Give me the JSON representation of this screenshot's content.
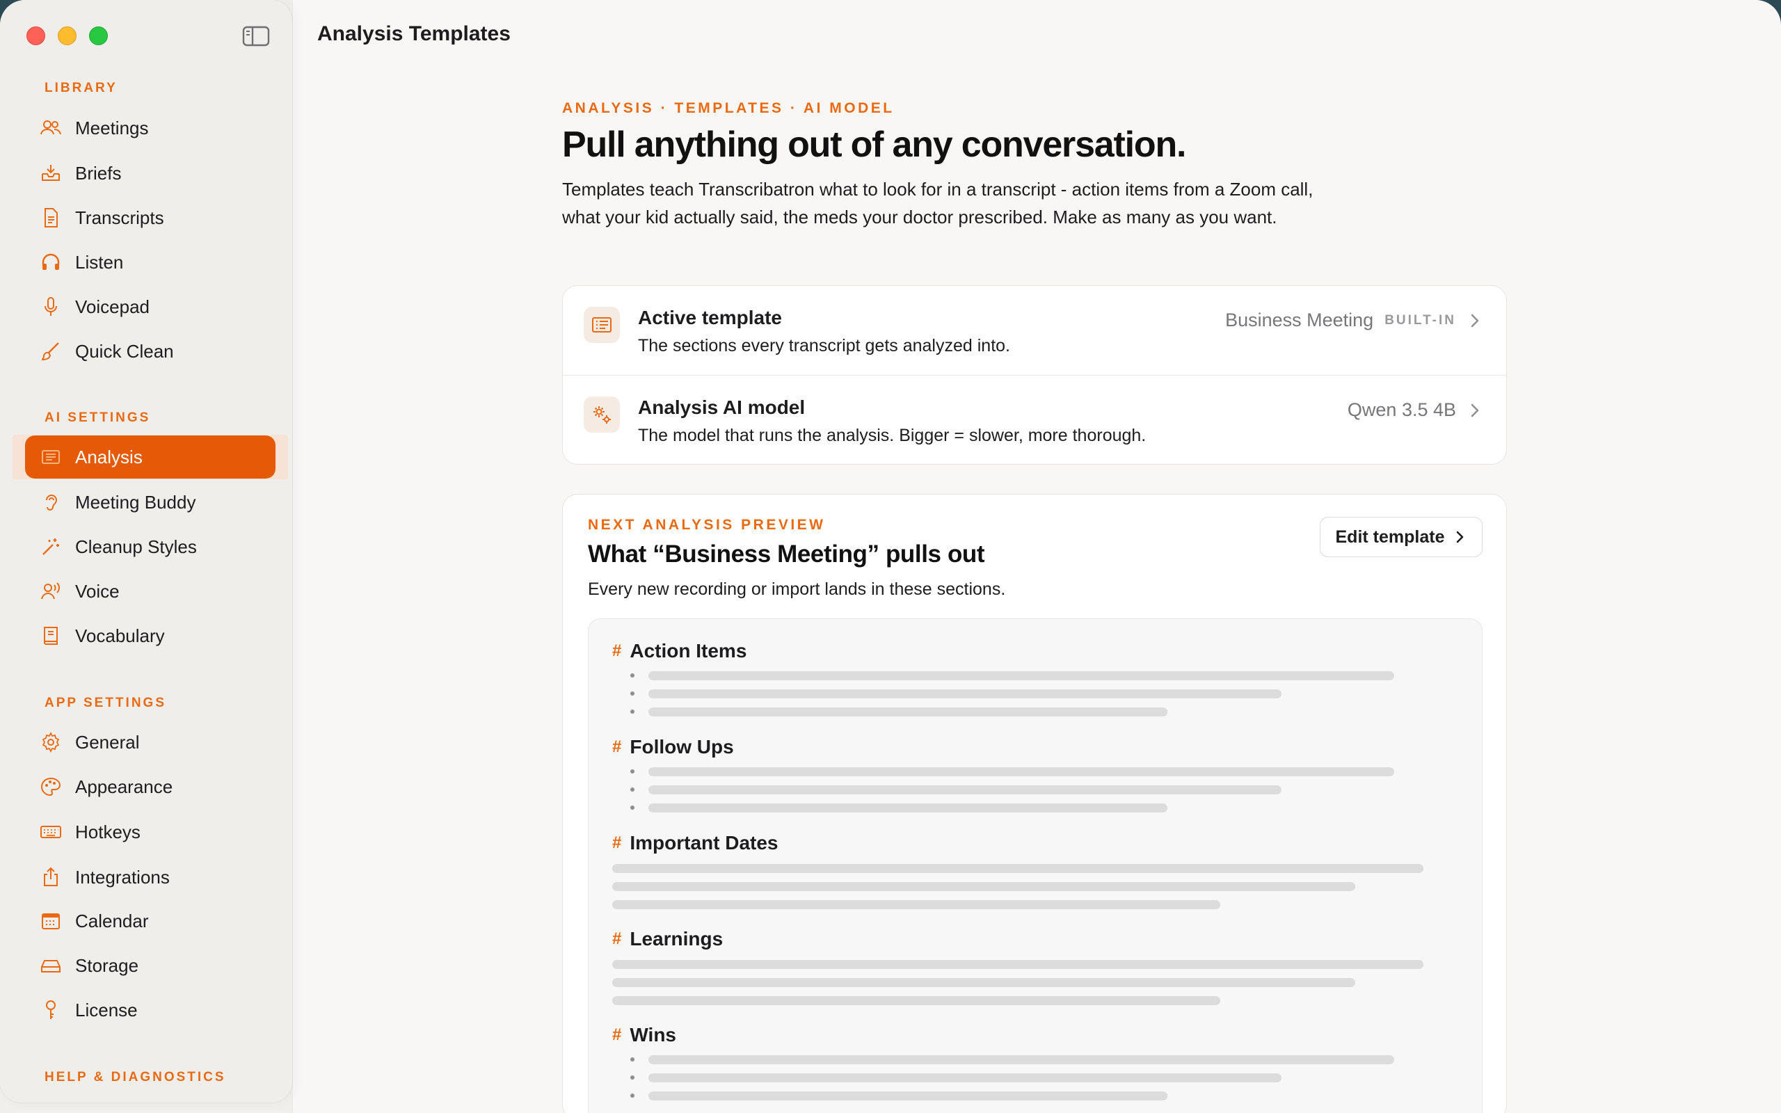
{
  "window": {
    "title": "Analysis Templates"
  },
  "sidebar": {
    "sections": [
      {
        "label": "LIBRARY"
      },
      {
        "label": "AI SETTINGS"
      },
      {
        "label": "APP SETTINGS"
      },
      {
        "label": "HELP & DIAGNOSTICS"
      }
    ],
    "items": [
      {
        "label": "Meetings",
        "icon": "people-icon"
      },
      {
        "label": "Briefs",
        "icon": "tray-download-icon"
      },
      {
        "label": "Transcripts",
        "icon": "document-icon"
      },
      {
        "label": "Listen",
        "icon": "headphones-icon"
      },
      {
        "label": "Voicepad",
        "icon": "microphone-icon"
      },
      {
        "label": "Quick Clean",
        "icon": "brush-icon"
      },
      {
        "label": "Analysis",
        "icon": "list-card-icon",
        "active": true
      },
      {
        "label": "Meeting Buddy",
        "icon": "ear-icon"
      },
      {
        "label": "Cleanup Styles",
        "icon": "magic-wand-icon"
      },
      {
        "label": "Voice",
        "icon": "person-wave-icon"
      },
      {
        "label": "Vocabulary",
        "icon": "book-icon"
      },
      {
        "label": "General",
        "icon": "gear-icon"
      },
      {
        "label": "Appearance",
        "icon": "palette-icon"
      },
      {
        "label": "Hotkeys",
        "icon": "keyboard-icon"
      },
      {
        "label": "Integrations",
        "icon": "share-icon"
      },
      {
        "label": "Calendar",
        "icon": "calendar-icon"
      },
      {
        "label": "Storage",
        "icon": "drive-icon"
      },
      {
        "label": "License",
        "icon": "key-icon"
      }
    ]
  },
  "main": {
    "eyebrow": "ANALYSIS · TEMPLATES · AI MODEL",
    "headline": "Pull anything out of any conversation.",
    "intro": "Templates teach Transcribatron what to look for in a transcript - action items from a Zoom call, what your kid actually said, the meds your doctor prescribed. Make as many as you want."
  },
  "settings": {
    "active_template": {
      "title": "Active template",
      "subtitle": "The sections every transcript gets analyzed into.",
      "value": "Business Meeting",
      "badge": "BUILT-IN"
    },
    "analysis_model": {
      "title": "Analysis AI model",
      "subtitle": "The model that runs the analysis. Bigger = slower, more thorough.",
      "value": "Qwen 3.5 4B"
    }
  },
  "preview": {
    "eyebrow": "NEXT ANALYSIS PREVIEW",
    "title": "What “Business Meeting” pulls out",
    "subtitle": "Every new recording or import lands in these sections.",
    "edit_label": "Edit template",
    "sections": [
      {
        "hash": "#",
        "title": "Action Items",
        "style": "bullets"
      },
      {
        "hash": "#",
        "title": "Follow Ups",
        "style": "bullets"
      },
      {
        "hash": "#",
        "title": "Important Dates",
        "style": "paragraph"
      },
      {
        "hash": "#",
        "title": "Learnings",
        "style": "paragraph"
      },
      {
        "hash": "#",
        "title": "Wins",
        "style": "bullets"
      }
    ]
  },
  "colors": {
    "accent": "#e45a07",
    "accent_text": "#ea6a12"
  }
}
